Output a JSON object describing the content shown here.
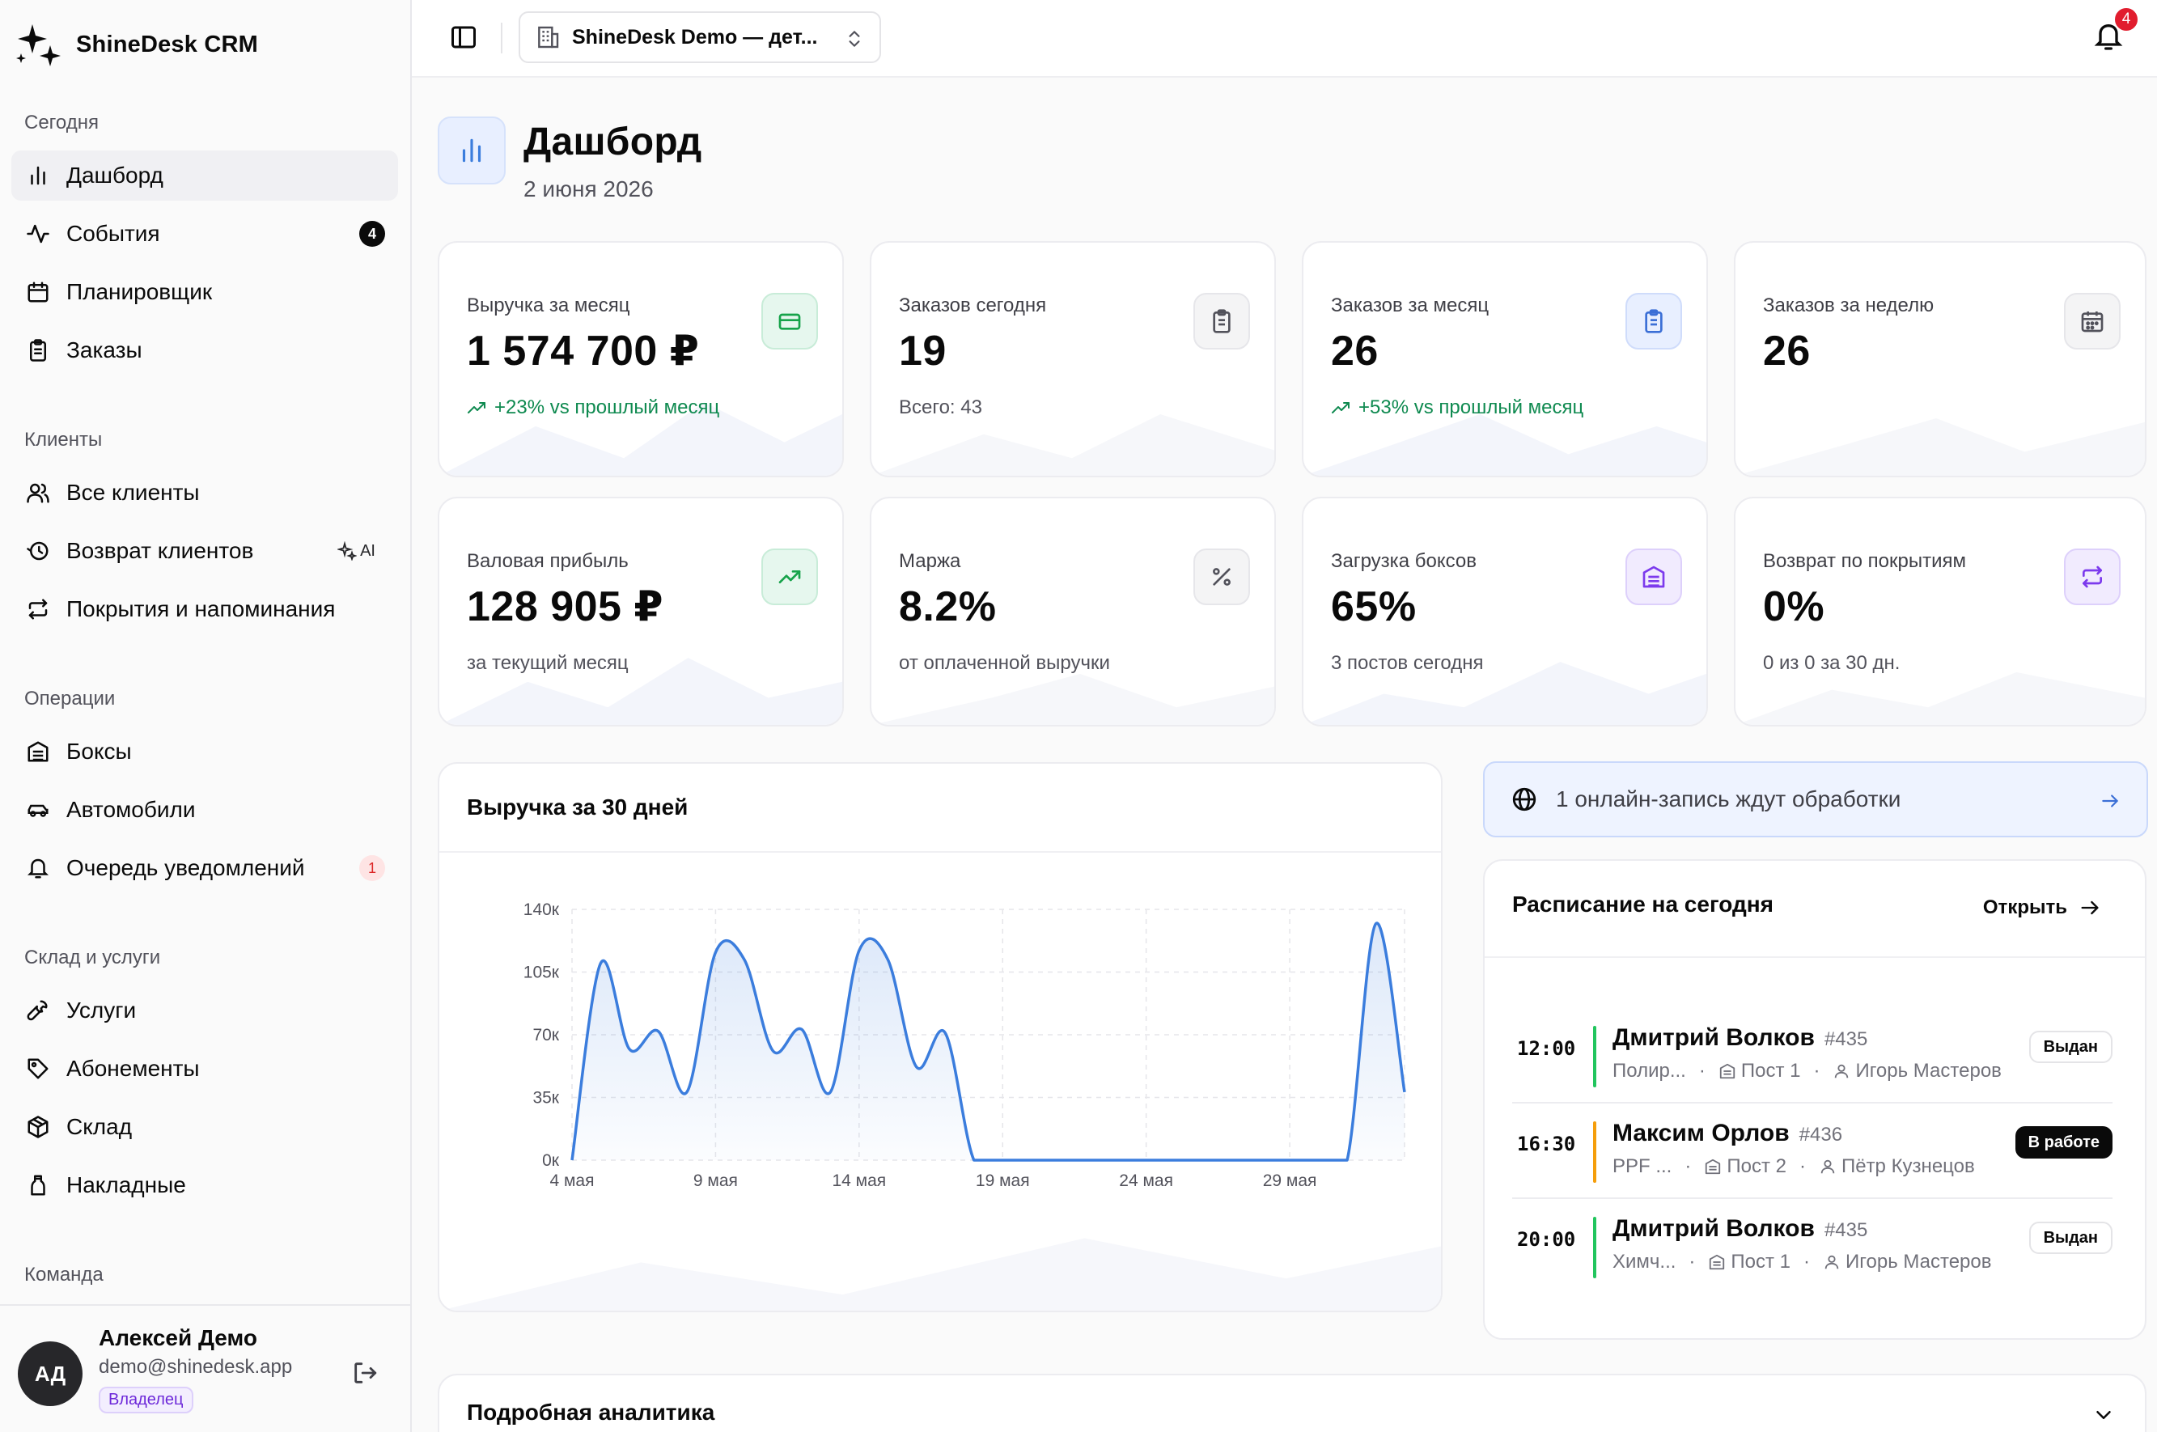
{
  "brand": {
    "name": "ShineDesk CRM",
    "icon": "sparkles-icon"
  },
  "nav": {
    "sections": [
      {
        "label": "Сегодня",
        "items": [
          {
            "label": "Дашборд",
            "icon": "bar-chart-icon",
            "active": true
          },
          {
            "label": "События",
            "icon": "activity-icon",
            "badge": "4"
          },
          {
            "label": "Планировщик",
            "icon": "calendar-icon"
          },
          {
            "label": "Заказы",
            "icon": "clipboard-icon"
          }
        ]
      },
      {
        "label": "Клиенты",
        "items": [
          {
            "label": "Все клиенты",
            "icon": "users-icon"
          },
          {
            "label": "Возврат клиентов",
            "icon": "history-icon",
            "tag": "AI"
          },
          {
            "label": "Покрытия и напоминания",
            "icon": "repeat-icon"
          }
        ]
      },
      {
        "label": "Операции",
        "items": [
          {
            "label": "Боксы",
            "icon": "warehouse-icon"
          },
          {
            "label": "Автомобили",
            "icon": "car-icon"
          },
          {
            "label": "Очередь уведомлений",
            "icon": "bell-icon",
            "badge": "1"
          }
        ]
      },
      {
        "label": "Склад и услуги",
        "items": [
          {
            "label": "Услуги",
            "icon": "wrench-icon"
          },
          {
            "label": "Абонементы",
            "icon": "tag-icon"
          },
          {
            "label": "Склад",
            "icon": "package-icon"
          },
          {
            "label": "Накладные",
            "icon": "receipt-icon"
          }
        ]
      },
      {
        "label": "Команда",
        "items": []
      }
    ]
  },
  "user": {
    "initials": "АД",
    "name": "Алексей Демо",
    "email": "demo@shinedesk.app",
    "role": "Владелец"
  },
  "topbar": {
    "tenant": "ShineDesk Demo — дет...",
    "notifications": "4"
  },
  "page": {
    "title": "Дашборд",
    "date": "2 июня 2026"
  },
  "kpis": [
    {
      "label": "Выручка за месяц",
      "value": "1 574 700 ₽",
      "sub": "+23% vs прошлый месяц",
      "trend": true,
      "icon": "credit-card-icon",
      "tone": "green"
    },
    {
      "label": "Заказов сегодня",
      "value": "19",
      "sub": "Всего: 43",
      "trend": false,
      "icon": "clipboard-icon",
      "tone": "gray"
    },
    {
      "label": "Заказов за месяц",
      "value": "26",
      "sub": "+53% vs прошлый месяц",
      "trend": true,
      "icon": "clipboard-icon",
      "tone": "blue"
    },
    {
      "label": "Заказов за неделю",
      "value": "26",
      "sub": "",
      "trend": false,
      "icon": "calendar-icon",
      "tone": "gray"
    },
    {
      "label": "Валовая прибыль",
      "value": "128 905 ₽",
      "sub": "за текущий месяц",
      "trend": false,
      "icon": "trending-up-icon",
      "tone": "green"
    },
    {
      "label": "Маржа",
      "value": "8.2%",
      "sub": "от оплаченной выручки",
      "trend": false,
      "icon": "percent-icon",
      "tone": "gray"
    },
    {
      "label": "Загрузка боксов",
      "value": "65%",
      "sub": "3 постов сегодня",
      "trend": false,
      "icon": "warehouse-icon",
      "tone": "purple"
    },
    {
      "label": "Возврат по покрытиям",
      "value": "0%",
      "sub": "0 из 0 за 30 дн.",
      "trend": false,
      "icon": "repeat-icon",
      "tone": "purple"
    }
  ],
  "revenue_chart": {
    "title": "Выручка за 30 дней"
  },
  "chart_data": {
    "type": "area",
    "title": "Выручка за 30 дней",
    "x": [
      "4 мая",
      "5 мая",
      "6 мая",
      "7 мая",
      "8 мая",
      "9 мая",
      "10 мая",
      "11 мая",
      "12 мая",
      "13 мая",
      "14 мая",
      "15 мая",
      "16 мая",
      "17 мая",
      "18 мая",
      "19 мая",
      "20 мая",
      "21 мая",
      "22 мая",
      "23 мая",
      "24 мая",
      "25 мая",
      "26 мая",
      "27 мая",
      "28 мая",
      "29 мая",
      "30 мая",
      "31 мая",
      "1 июня",
      "2 июня"
    ],
    "xticks": [
      "4 мая",
      "9 мая",
      "14 мая",
      "19 мая",
      "24 мая",
      "29 мая"
    ],
    "yticks": [
      "0к",
      "35к",
      "70к",
      "105к",
      "140к"
    ],
    "ylim": [
      0,
      140000
    ],
    "values": [
      0,
      110000,
      62000,
      72000,
      38000,
      116000,
      112000,
      61000,
      73000,
      38000,
      117000,
      112000,
      52000,
      71000,
      0,
      0,
      0,
      0,
      0,
      0,
      0,
      0,
      0,
      0,
      0,
      0,
      0,
      0,
      132000,
      38000
    ],
    "color": "#3b7ddd",
    "grid": true
  },
  "online_banner": {
    "text": "1 онлайн-запись ждут обработки",
    "icon": "globe-icon"
  },
  "schedule": {
    "title": "Расписание на сегодня",
    "open_label": "Открыть",
    "slots": [
      {
        "time": "12:00",
        "name": "Дмитрий Волков",
        "num": "#435",
        "service": "Полир...",
        "post": "Пост 1",
        "master": "Игорь Мастеров",
        "status": "Выдан",
        "status_style": "outline",
        "color": "#22c55e"
      },
      {
        "time": "16:30",
        "name": "Максим Орлов",
        "num": "#436",
        "service": "PPF ...",
        "post": "Пост 2",
        "master": "Пётр Кузнецов",
        "status": "В работе",
        "status_style": "filled",
        "color": "#f59e0b"
      },
      {
        "time": "20:00",
        "name": "Дмитрий Волков",
        "num": "#435",
        "service": "Химч...",
        "post": "Пост 1",
        "master": "Игорь Мастеров",
        "status": "Выдан",
        "status_style": "outline",
        "color": "#22c55e"
      }
    ]
  },
  "analytics": {
    "title": "Подробная аналитика"
  }
}
